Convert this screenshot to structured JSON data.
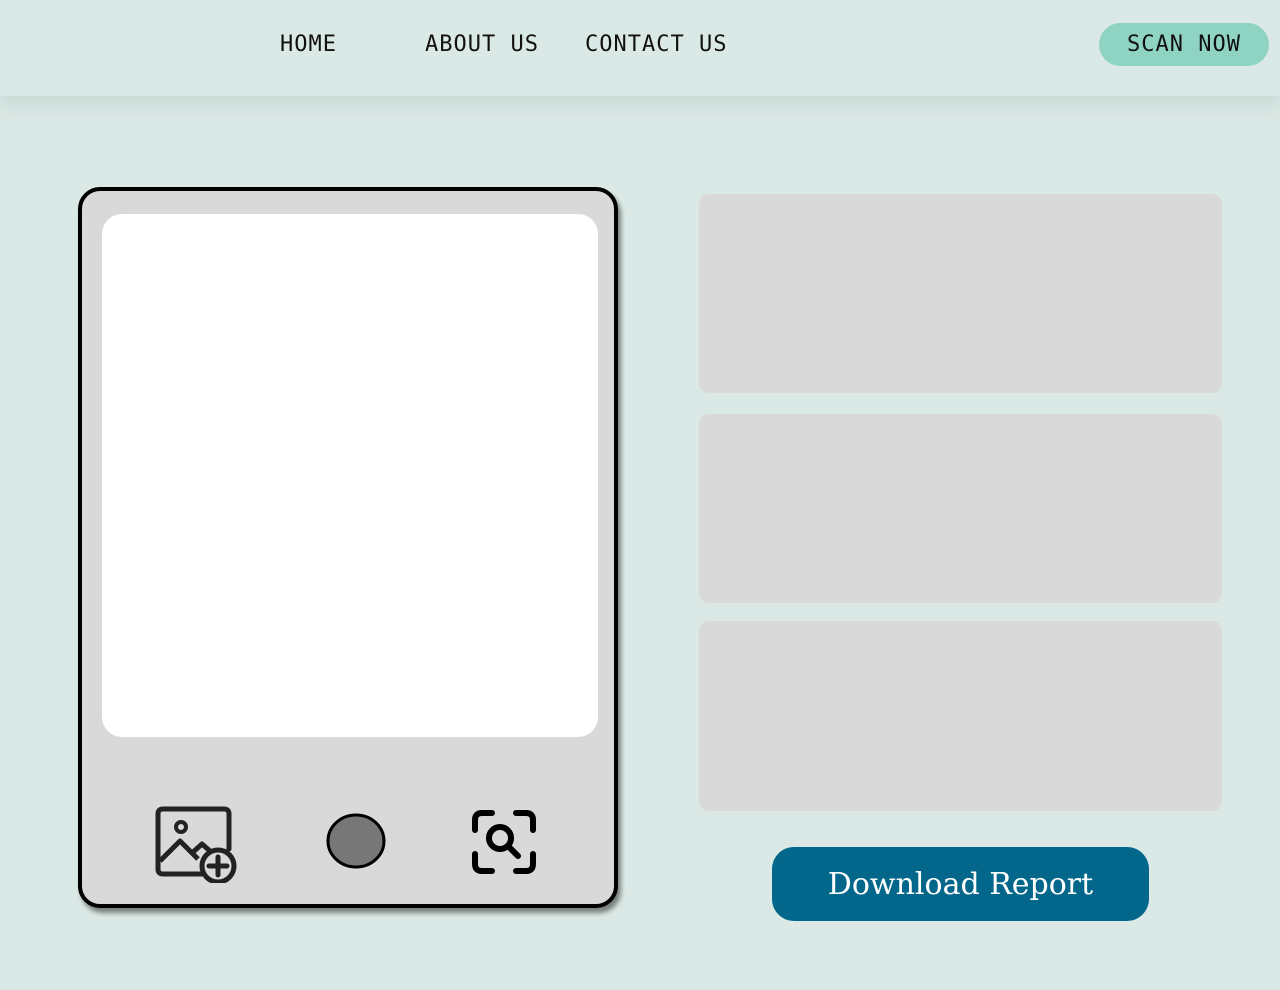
{
  "nav": {
    "home": "HOME",
    "about": "ABOUT US",
    "contact": "CONTACT US",
    "scan_now": "SCAN NOW"
  },
  "scanner": {
    "icons": {
      "add_image": "add-image-icon",
      "shutter": "shutter-icon",
      "scan_search": "scan-search-icon"
    }
  },
  "report": {
    "download_label": "Download Report"
  },
  "colors": {
    "background": "#dbe9e6",
    "accent": "#8fd3c3",
    "primary": "#02678a",
    "panel": "#d9d9d9"
  }
}
